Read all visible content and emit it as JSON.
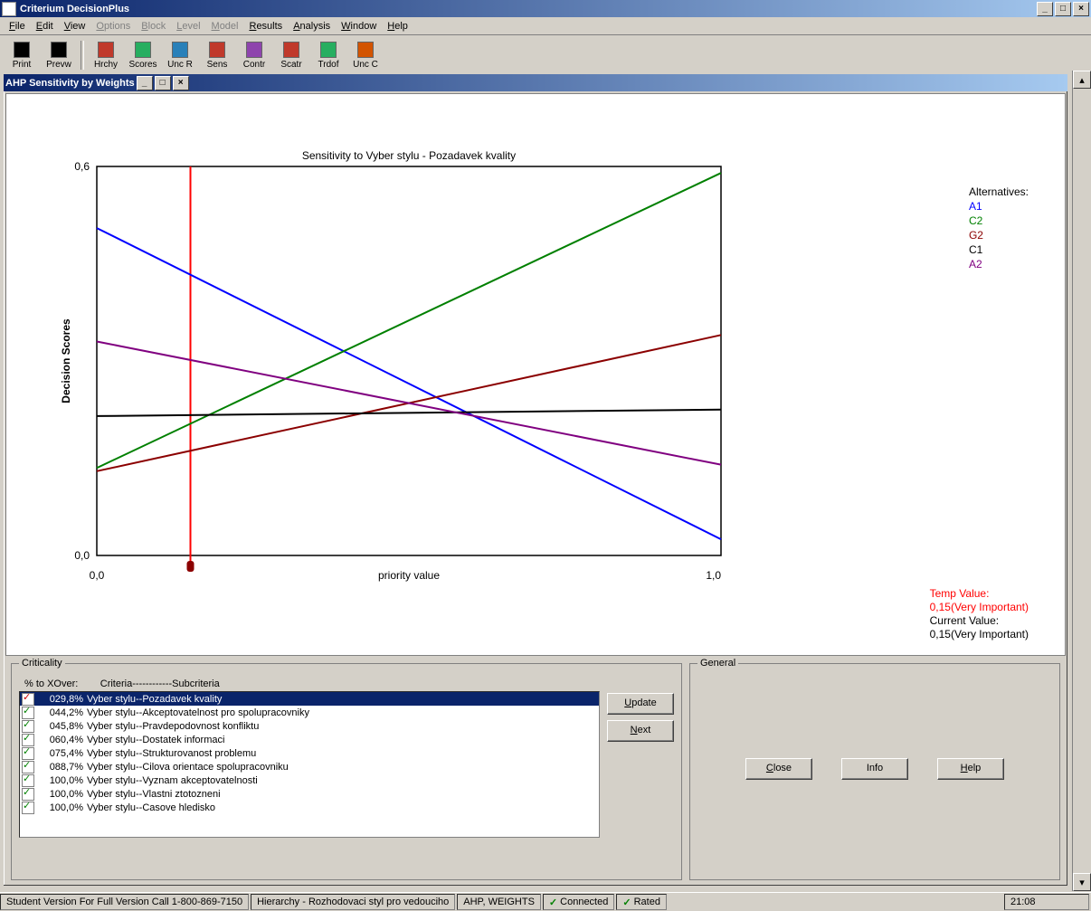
{
  "app_title": "Criterium DecisionPlus",
  "menu": [
    "File",
    "Edit",
    "View",
    "Options",
    "Block",
    "Level",
    "Model",
    "Results",
    "Analysis",
    "Window",
    "Help"
  ],
  "menu_disabled": [
    3,
    4,
    5,
    6
  ],
  "toolbar": [
    {
      "label": "Print",
      "icon": "print-icon",
      "color": "#000"
    },
    {
      "label": "Prevw",
      "icon": "preview-icon",
      "color": "#000"
    },
    {
      "sep": true
    },
    {
      "label": "Hrchy",
      "icon": "hierarchy-icon",
      "color": "#c0392b"
    },
    {
      "label": "Scores",
      "icon": "scores-icon",
      "color": "#27ae60"
    },
    {
      "label": "Unc R",
      "icon": "uncr-icon",
      "color": "#2980b9"
    },
    {
      "label": "Sens",
      "icon": "sens-icon",
      "color": "#c0392b"
    },
    {
      "label": "Contr",
      "icon": "contr-icon",
      "color": "#8e44ad"
    },
    {
      "label": "Scatr",
      "icon": "scatter-icon",
      "color": "#c0392b"
    },
    {
      "label": "Trdof",
      "icon": "tradeoff-icon",
      "color": "#27ae60"
    },
    {
      "label": "Unc C",
      "icon": "uncc-icon",
      "color": "#d35400"
    }
  ],
  "child_title": "AHP Sensitivity by Weights",
  "chart_title": "Sensitivity to Vyber stylu - Pozadavek kvality",
  "ylabel": "Decision Scores",
  "xlabel": "priority value",
  "yticks": [
    "0,0",
    "0,6"
  ],
  "xticks": [
    "0,0",
    "1,0"
  ],
  "legend_title": "Alternatives:",
  "legend": [
    {
      "name": "A1",
      "color": "#0000ff"
    },
    {
      "name": "C2",
      "color": "#008000"
    },
    {
      "name": "G2",
      "color": "#8b0000"
    },
    {
      "name": "C1",
      "color": "#000000"
    },
    {
      "name": "A2",
      "color": "#800080"
    }
  ],
  "values_box": {
    "temp_label": "Temp Value:",
    "temp_value": "0,15(Very Important)",
    "cur_label": "Current Value:",
    "cur_value": "0,15(Very Important)"
  },
  "chart_data": {
    "type": "line",
    "xlabel": "priority value",
    "ylabel": "Decision Scores",
    "xlim": [
      0,
      1
    ],
    "ylim": [
      0,
      0.6
    ],
    "marker_x": 0.15,
    "series": [
      {
        "name": "A1",
        "color": "#0000ff",
        "points": [
          [
            0,
            0.505
          ],
          [
            1,
            0.025
          ]
        ]
      },
      {
        "name": "C2",
        "color": "#008000",
        "points": [
          [
            0,
            0.135
          ],
          [
            1,
            0.59
          ]
        ]
      },
      {
        "name": "G2",
        "color": "#8b0000",
        "points": [
          [
            0,
            0.13
          ],
          [
            1,
            0.34
          ]
        ]
      },
      {
        "name": "C1",
        "color": "#000000",
        "points": [
          [
            0,
            0.215
          ],
          [
            1,
            0.225
          ]
        ]
      },
      {
        "name": "A2",
        "color": "#800080",
        "points": [
          [
            0,
            0.33
          ],
          [
            1,
            0.14
          ]
        ]
      }
    ]
  },
  "criticality_title": "Criticality",
  "criticality_header_pct": "% to XOver:",
  "criticality_header_crit": "Criteria------------Subcriteria",
  "criticality_rows": [
    {
      "pct": "029,8%",
      "text": "Vyber stylu--Pozadavek kvality",
      "selected": true
    },
    {
      "pct": "044,2%",
      "text": "Vyber stylu--Akceptovatelnost pro spolupracovniky"
    },
    {
      "pct": "045,8%",
      "text": "Vyber stylu--Pravdepodovnost konfliktu"
    },
    {
      "pct": "060,4%",
      "text": "Vyber stylu--Dostatek informaci"
    },
    {
      "pct": "075,4%",
      "text": "Vyber stylu--Strukturovanost problemu"
    },
    {
      "pct": "088,7%",
      "text": "Vyber stylu--Cilova orientace spolupracovniku"
    },
    {
      "pct": "100,0%",
      "text": "Vyber stylu--Vyznam akceptovatelnosti"
    },
    {
      "pct": "100,0%",
      "text": "Vyber stylu--Vlastni ztotozneni"
    },
    {
      "pct": "100,0%",
      "text": "Vyber stylu--Casove hledisko"
    }
  ],
  "btn_update": "Update",
  "btn_next": "Next",
  "general_title": "General",
  "btn_close": "Close",
  "btn_info": "Info",
  "btn_help": "Help",
  "status": {
    "version": "Student Version For Full Version Call 1-800-869-7150",
    "hierarchy": "Hierarchy - Rozhodovaci styl pro vedouciho",
    "method": "AHP, WEIGHTS",
    "connected": "Connected",
    "rated": "Rated",
    "time": "21:08"
  }
}
